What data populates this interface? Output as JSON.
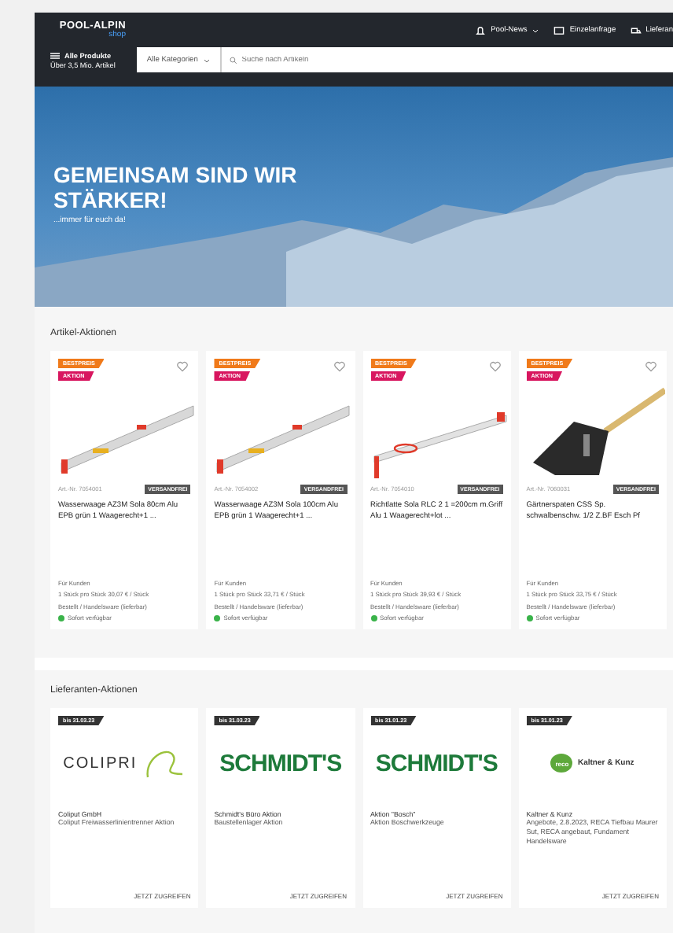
{
  "header": {
    "logo": {
      "name": "POOL-ALPIN",
      "sub": "shop"
    },
    "all_products": {
      "label": "Alle Produkte",
      "sub": "Über 3,5 Mio. Artikel"
    },
    "category_select": "Alle Kategorien",
    "search": {
      "placeholder": "Suche nach Artikeln"
    },
    "nav": [
      {
        "label": "Pool-News",
        "kind": "news",
        "dropdown": true
      },
      {
        "label": "Einzelanfrage",
        "kind": "request",
        "dropdown": false
      },
      {
        "label": "Lieferan",
        "kind": "supplier",
        "dropdown": false
      }
    ]
  },
  "hero": {
    "title": "GEMEINSAM SIND WIR STÄRKER!",
    "subtitle": "...immer für euch da!"
  },
  "article_section": {
    "title": "Artikel-Aktionen",
    "products": [
      {
        "kind": "level",
        "badges": [
          {
            "label": "BESTPREIS",
            "kind": "best"
          },
          {
            "label": "AKTION",
            "kind": "promo"
          }
        ],
        "brand": "Art.-Nr. 7054001",
        "tag": "VERSANDFREI",
        "title": "Wasserwaage AZ3M Sola 80cm Alu EPB grün 1 Waagerecht+1 ...",
        "customer": "Für Kunden",
        "price": "1 Stück pro Stück 30,07 € / Stück",
        "stock_note": "Bestellt / Handelsware (lieferbar)",
        "availability": "Sofort verfügbar"
      },
      {
        "kind": "level",
        "badges": [
          {
            "label": "BESTPREIS",
            "kind": "best"
          },
          {
            "label": "AKTION",
            "kind": "promo"
          }
        ],
        "brand": "Art.-Nr. 7054002",
        "tag": "VERSANDFREI",
        "title": "Wasserwaage AZ3M Sola 100cm Alu EPB grün 1 Waagerecht+1 ...",
        "customer": "Für Kunden",
        "price": "1 Stück pro Stück 33,71 € / Stück",
        "stock_note": "Bestellt / Handelsware (lieferbar)",
        "availability": "Sofort verfügbar"
      },
      {
        "kind": "straightedge",
        "badges": [
          {
            "label": "BESTPREIS",
            "kind": "best"
          },
          {
            "label": "AKTION",
            "kind": "promo"
          }
        ],
        "brand": "Art.-Nr. 7054010",
        "tag": "VERSANDFREI",
        "title": "Richtlatte Sola RLC 2 1 =200cm m.Griff Alu 1 Waagerecht+lot ...",
        "customer": "Für Kunden",
        "price": "1 Stück pro Stück 39,93 € / Stück",
        "stock_note": "Bestellt / Handelsware (lieferbar)",
        "availability": "Sofort verfügbar"
      },
      {
        "kind": "spade",
        "badges": [
          {
            "label": "BESTPREIS",
            "kind": "best"
          },
          {
            "label": "AKTION",
            "kind": "promo"
          }
        ],
        "brand": "Art.-Nr. 7060031",
        "tag": "VERSANDFREI",
        "title": "Gärtnerspaten CSS Sp. schwalbenschw. 1/2 Z.BF Esch Pf",
        "customer": "Für Kunden",
        "price": "1 Stück pro Stück 33,75 € / Stück",
        "stock_note": "Bestellt / Handelsware (lieferbar)",
        "availability": "Sofort verfügbar"
      }
    ]
  },
  "supplier_section": {
    "title": "Lieferanten-Aktionen",
    "suppliers": [
      {
        "badge": "bis 31.03.23",
        "logo": {
          "kind": "colipri",
          "text": "COLIPRI"
        },
        "name": "Coliput GmbH",
        "description": "Coliput Freiwasserlinientrenner Aktion",
        "link": "JETZT ZUGREIFEN"
      },
      {
        "badge": "bis 31.03.23",
        "logo": {
          "kind": "schmidts",
          "text": "SCHMIDT'S"
        },
        "name": "Schmidt's Büro Aktion",
        "description": "Baustellenlager Aktion",
        "link": "JETZT ZUGREIFEN"
      },
      {
        "badge": "bis 31.01.23",
        "logo": {
          "kind": "schmidts",
          "text": "SCHMIDT'S"
        },
        "name": "Aktion \"Bosch\"",
        "description": "Aktion Boschwerkzeuge",
        "link": "JETZT ZUGREIFEN"
      },
      {
        "badge": "bis 31.01.23",
        "logo": {
          "kind": "reco",
          "text": "Kaltner & Kunz",
          "sub": "reco"
        },
        "name": "Kaltner & Kunz",
        "description": "Angebote, 2.8.2023, RECA Tiefbau Maurer Sut, RECA angebaut, Fundament Handelsware",
        "link": "JETZT ZUGREIFEN"
      }
    ]
  }
}
